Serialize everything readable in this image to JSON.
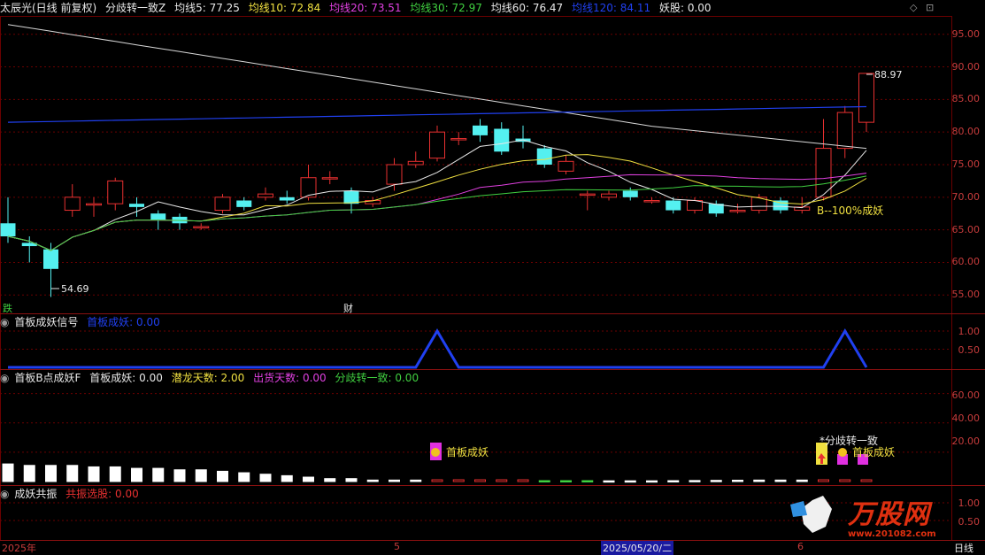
{
  "header": {
    "stock_name": "太辰光(日线 前复权)",
    "indicator_name": "分歧转一致Z",
    "ma": [
      {
        "label": "均线5: 77.25",
        "color": "#e8e8e8"
      },
      {
        "label": "均线10: 72.84",
        "color": "#f0e040"
      },
      {
        "label": "均线20: 73.51",
        "color": "#e040e0"
      },
      {
        "label": "均线30: 72.97",
        "color": "#40d040"
      },
      {
        "label": "均线60: 76.47",
        "color": "#e8e8e8"
      },
      {
        "label": "均线120: 84.11",
        "color": "#2040f0"
      }
    ],
    "yao": "妖股: 0.00"
  },
  "main_axis": {
    "ticks": [
      "95.00",
      "90.00",
      "85.00",
      "80.00",
      "75.00",
      "70.00",
      "65.00",
      "60.00",
      "55.00"
    ],
    "high_label": "88.97",
    "low_label": "54.69",
    "signal_label": "B--100%成妖",
    "marker_die": "跌",
    "marker_cai": "财"
  },
  "panel1": {
    "title": "首板成妖信号",
    "value_label": "首板成妖: 0.00",
    "ticks": [
      "1.00",
      "0.50"
    ],
    "series": [
      0,
      0,
      0,
      0,
      0,
      0,
      0,
      0,
      0,
      0,
      0,
      0,
      0,
      0,
      0,
      0,
      0,
      0,
      0,
      0,
      1,
      0,
      0,
      0,
      0,
      0,
      0,
      0,
      0,
      0,
      0,
      0,
      0,
      0,
      0,
      0,
      0,
      0,
      0,
      1,
      0
    ]
  },
  "panel2": {
    "title": "首板B点成妖F",
    "items": [
      {
        "label": "首板成妖: 0.00",
        "color": "#e8e8e8"
      },
      {
        "label": "潜龙天数: 2.00",
        "color": "#f0e040"
      },
      {
        "label": "出货天数: 0.00",
        "color": "#e040e0"
      },
      {
        "label": "分歧转一致: 0.00",
        "color": "#40d040"
      }
    ],
    "ticks": [
      "60.00",
      "40.00",
      "20.00"
    ],
    "annot1": "首板成妖",
    "annot2": "*分歧转一致",
    "annot3": "首板成妖"
  },
  "panel3": {
    "title": "成妖共振",
    "value_label": "共振选股: 0.00",
    "ticks": [
      "1.00",
      "0.50"
    ]
  },
  "bottom_axis": {
    "year": "2025年",
    "mark_5": "5",
    "date": "2025/05/20/二",
    "mark_6": "6",
    "period": "日线"
  },
  "watermark": {
    "brand": "万股网",
    "url": "www.201082.com"
  },
  "chart_data": {
    "type": "candlestick",
    "ylim": [
      53,
      97
    ],
    "candles": [
      {
        "o": 66,
        "c": 64,
        "h": 70,
        "l": 63
      },
      {
        "o": 63,
        "c": 62.5,
        "h": 64,
        "l": 60
      },
      {
        "o": 62,
        "c": 59,
        "h": 63,
        "l": 54.69
      },
      {
        "o": 68,
        "c": 70,
        "h": 72,
        "l": 67
      },
      {
        "o": 69,
        "c": 69,
        "h": 70,
        "l": 67
      },
      {
        "o": 69,
        "c": 72.5,
        "h": 73,
        "l": 68
      },
      {
        "o": 69,
        "c": 68.5,
        "h": 70,
        "l": 67
      },
      {
        "o": 67.5,
        "c": 66.5,
        "h": 68,
        "l": 65
      },
      {
        "o": 67,
        "c": 66,
        "h": 67.5,
        "l": 65
      },
      {
        "o": 65.5,
        "c": 65.5,
        "h": 66,
        "l": 65
      },
      {
        "o": 68,
        "c": 70,
        "h": 70.5,
        "l": 67.5
      },
      {
        "o": 69.5,
        "c": 68.5,
        "h": 70,
        "l": 68
      },
      {
        "o": 70,
        "c": 70.5,
        "h": 71.5,
        "l": 69.5
      },
      {
        "o": 70,
        "c": 69.5,
        "h": 71,
        "l": 69
      },
      {
        "o": 70,
        "c": 73,
        "h": 75,
        "l": 69.5
      },
      {
        "o": 73,
        "c": 73,
        "h": 74,
        "l": 72
      },
      {
        "o": 71,
        "c": 69,
        "h": 71.5,
        "l": 67.5
      },
      {
        "o": 69,
        "c": 69.5,
        "h": 70,
        "l": 68.5
      },
      {
        "o": 72,
        "c": 75,
        "h": 76,
        "l": 71
      },
      {
        "o": 75,
        "c": 75.5,
        "h": 77,
        "l": 74.5
      },
      {
        "o": 76,
        "c": 80,
        "h": 81,
        "l": 75.5
      },
      {
        "o": 79,
        "c": 79,
        "h": 80,
        "l": 78
      },
      {
        "o": 81,
        "c": 79.5,
        "h": 82,
        "l": 78.5
      },
      {
        "o": 80.5,
        "c": 77,
        "h": 81.5,
        "l": 76.5
      },
      {
        "o": 79,
        "c": 78.5,
        "h": 81,
        "l": 77.5
      },
      {
        "o": 77.5,
        "c": 75,
        "h": 78,
        "l": 74.5
      },
      {
        "o": 74,
        "c": 75.5,
        "h": 76.5,
        "l": 73.5
      },
      {
        "o": 70.5,
        "c": 70.5,
        "h": 71,
        "l": 68
      },
      {
        "o": 70,
        "c": 70.5,
        "h": 71,
        "l": 69.5
      },
      {
        "o": 71,
        "c": 70,
        "h": 71.5,
        "l": 69.5
      },
      {
        "o": 69.5,
        "c": 69.5,
        "h": 70,
        "l": 69
      },
      {
        "o": 69.5,
        "c": 68,
        "h": 70,
        "l": 67.5
      },
      {
        "o": 68,
        "c": 69.5,
        "h": 70,
        "l": 67.5
      },
      {
        "o": 69,
        "c": 67.5,
        "h": 69.5,
        "l": 67
      },
      {
        "o": 68,
        "c": 68,
        "h": 69,
        "l": 67.5
      },
      {
        "o": 68,
        "c": 70,
        "h": 70.5,
        "l": 67.5
      },
      {
        "o": 69.5,
        "c": 68,
        "h": 70,
        "l": 67.5
      },
      {
        "o": 68,
        "c": 68.5,
        "h": 70,
        "l": 67.5
      },
      {
        "o": 70,
        "c": 77.5,
        "h": 82,
        "l": 69.5
      },
      {
        "o": 77.5,
        "c": 83,
        "h": 84,
        "l": 76
      },
      {
        "o": 81.5,
        "c": 89,
        "h": 89,
        "l": 80
      }
    ]
  },
  "colors": {
    "up": "#e83030",
    "down": "#54f0f0",
    "grid": "#6b0000",
    "axis": "#c83c3c"
  }
}
